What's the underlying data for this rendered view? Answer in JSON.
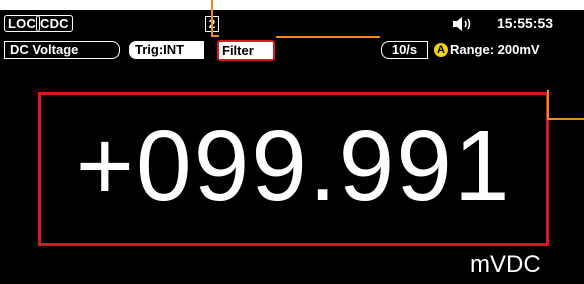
{
  "status_bar": {
    "loc_label": "LOC",
    "cdc_label": "CDC",
    "screen_number": "2",
    "clock": "15:55:53",
    "icons": {
      "speaker": "speaker-icon"
    }
  },
  "function_bar": {
    "function_label": "DC Voltage",
    "trigger_label": "Trig:INT",
    "filter_label": "Filter",
    "rate_label": "10/s",
    "auto_label": "A",
    "range_label": "Range: 200mV"
  },
  "measurement": {
    "reading": "+099.991",
    "unit": "mVDC"
  },
  "colors": {
    "screen_background": "#000000",
    "highlight_box": "#e0161e",
    "callout": "#f08a1c",
    "auto_badge": "#f2d211",
    "text": "#ffffff"
  }
}
